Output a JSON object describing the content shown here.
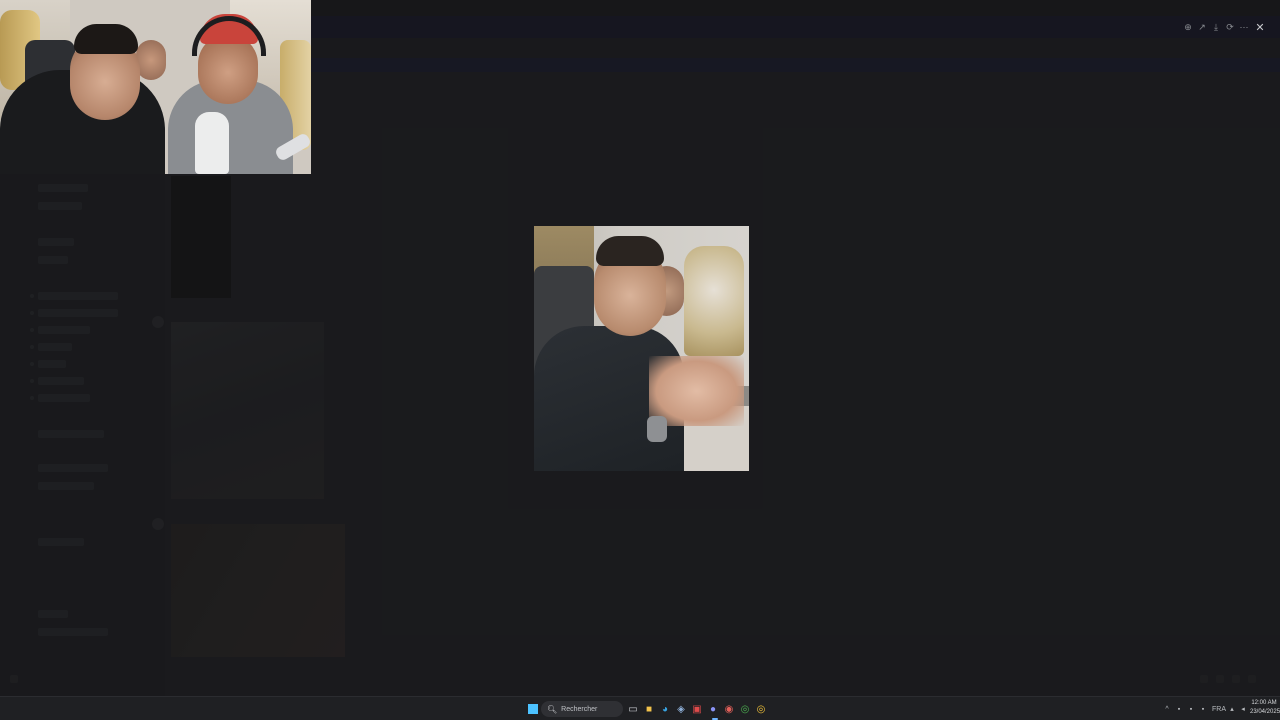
{
  "taskbar": {
    "search_placeholder": "Rechercher",
    "language": "FRA",
    "time": "12:00 AM",
    "date": "23/04/2025"
  },
  "viewer": {
    "tools": [
      "zoom-in-icon",
      "external-open-icon",
      "download-icon",
      "forward-icon",
      "more-icon"
    ],
    "close_label": "✕"
  },
  "colors": {
    "taskbar_bg": "#1f2023",
    "app_bg": "#222326",
    "accent": "#4cc2ff",
    "topbar_bg": "#1a1a2e"
  },
  "icons": {
    "taskbar": [
      "start-icon",
      "search-icon",
      "task-view-icon",
      "file-explorer-icon",
      "edge-icon",
      "app-icon",
      "app-red-icon",
      "discord-icon",
      "app-active-icon",
      "chrome-icon",
      "chrome-alt-icon"
    ],
    "tray": [
      "chevron-up-icon",
      "network-icon",
      "speaker-icon",
      "battery-icon",
      "notification-icon"
    ]
  }
}
